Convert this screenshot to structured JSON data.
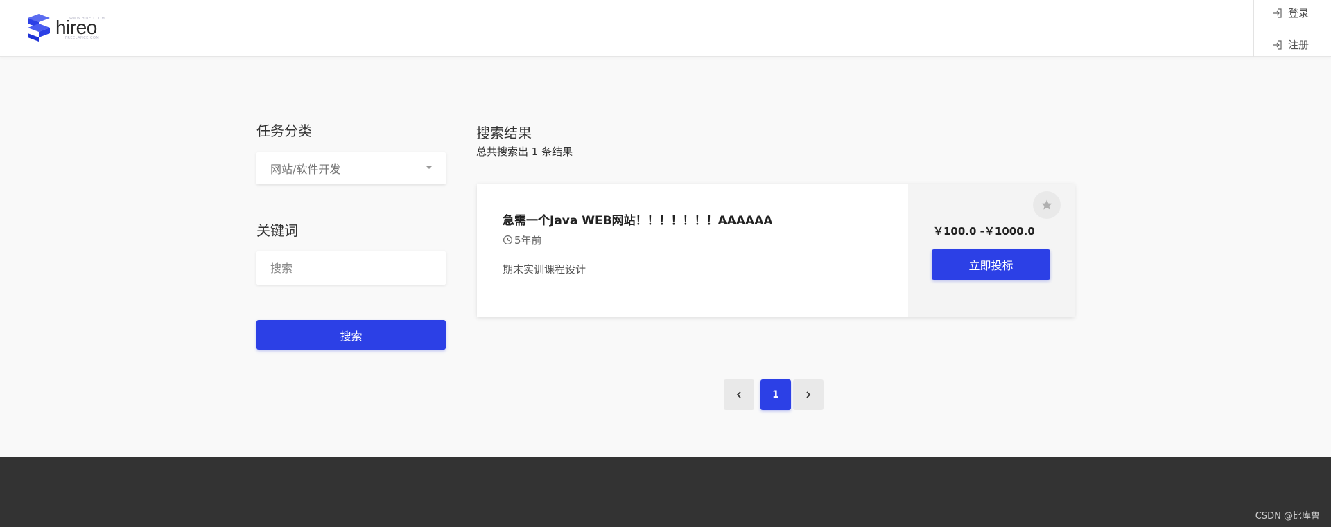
{
  "header": {
    "logo_text": "hireo",
    "logo_tiny_top": "WWW.HIREO.COM",
    "logo_tiny_bottom": "FREELANCE.COM",
    "login_label": "登录",
    "register_label": "注册"
  },
  "sidebar": {
    "category_title": "任务分类",
    "category_selected": "网站/软件开发",
    "keyword_title": "关键词",
    "keyword_placeholder": "搜索",
    "search_button": "搜索"
  },
  "results": {
    "title": "搜索结果",
    "count_text": "总共搜索出 1 条结果",
    "items": [
      {
        "title": "急需一个Java WEB网站！！！！！！！AAAAAA",
        "time": "5年前",
        "description": "期末实训课程设计",
        "price": "￥100.0 -￥1000.0",
        "bid_label": "立即投标",
        "bookmark_icon": "star-icon"
      }
    ]
  },
  "pagination": {
    "pages": [
      "1"
    ],
    "current": "1"
  },
  "footer": {
    "watermark": "CSDN @比库鲁"
  },
  "colors": {
    "accent": "#2c40e6",
    "footer": "#333333",
    "background": "#f9f9f9"
  }
}
